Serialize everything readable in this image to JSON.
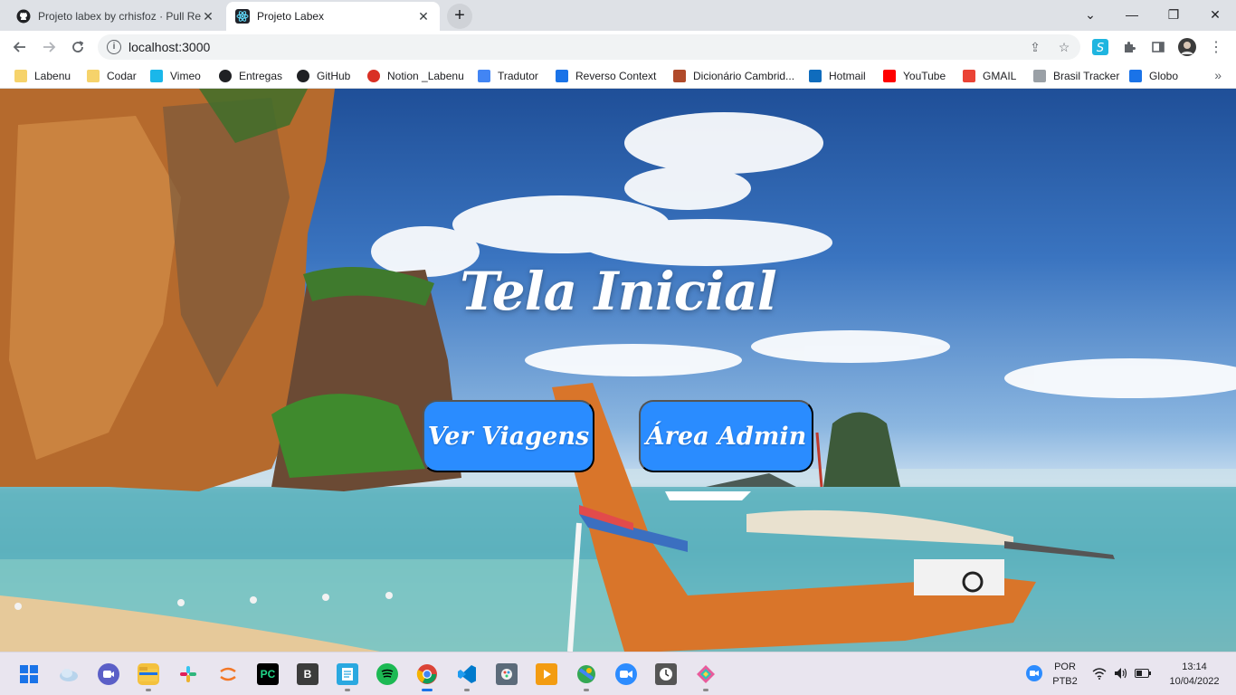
{
  "browser": {
    "tabs": [
      {
        "title": "Projeto labex by crhisfoz · Pull Re",
        "icon": "github-icon",
        "active": false
      },
      {
        "title": "Projeto Labex",
        "icon": "react-icon",
        "active": true
      }
    ],
    "new_tab_label": "+",
    "url": "localhost:3000",
    "window_controls": {
      "tab_search": "⌄",
      "minimize": "—",
      "restore": "❐",
      "close": "✕"
    }
  },
  "bookmarks": [
    {
      "label": "Labenu",
      "icon": "folder-icon",
      "color": "#f6d36b"
    },
    {
      "label": "Codar",
      "icon": "folder-icon",
      "color": "#f6d36b"
    },
    {
      "label": "Vimeo",
      "icon": "vimeo-icon",
      "color": "#1ab7ea"
    },
    {
      "label": "Entregas",
      "icon": "circle-icon",
      "color": "#202124"
    },
    {
      "label": "GitHub",
      "icon": "github-icon",
      "color": "#202124"
    },
    {
      "label": "Notion _Labenu",
      "icon": "apple-icon",
      "color": "#d93025"
    },
    {
      "label": "Tradutor",
      "icon": "translate-icon",
      "color": "#4285f4"
    },
    {
      "label": "Reverso Context",
      "icon": "reverso-icon",
      "color": "#1a73e8"
    },
    {
      "label": "Dicionário Cambrid...",
      "icon": "cambridge-icon",
      "color": "#b04a2a"
    },
    {
      "label": "Hotmail",
      "icon": "outlook-icon",
      "color": "#0f6cbd"
    },
    {
      "label": "YouTube",
      "icon": "youtube-icon",
      "color": "#ff0000"
    },
    {
      "label": "GMAIL",
      "icon": "gmail-icon",
      "color": "#ea4335"
    },
    {
      "label": "Brasil Tracker",
      "icon": "lock-icon",
      "color": "#9aa0a6"
    },
    {
      "label": "Globo",
      "icon": "globo-icon",
      "color": "#1a73e8"
    }
  ],
  "bookmarks_overflow": "»",
  "page": {
    "title": "Tela Inicial",
    "buttons": {
      "trips": "Ver Viagens",
      "admin": "Área Admin"
    },
    "button_color": "#2a8cff"
  },
  "taskbar": {
    "apps": [
      "start-icon",
      "weather-icon",
      "teams-icon",
      "explorer-icon",
      "slack-icon",
      "jupyter-icon",
      "pycharm-icon",
      "b-app-icon",
      "notepad-icon",
      "spotify-icon",
      "chrome-icon",
      "vscode-icon",
      "paint-icon",
      "media-icon",
      "maps-icon",
      "zoom-icon",
      "clock-icon",
      "sourcetree-icon"
    ],
    "language": "POR",
    "keyboard": "PTB2",
    "time": "13:14",
    "date": "10/04/2022",
    "pycharm_label": "PC",
    "b_app_label": "B"
  }
}
